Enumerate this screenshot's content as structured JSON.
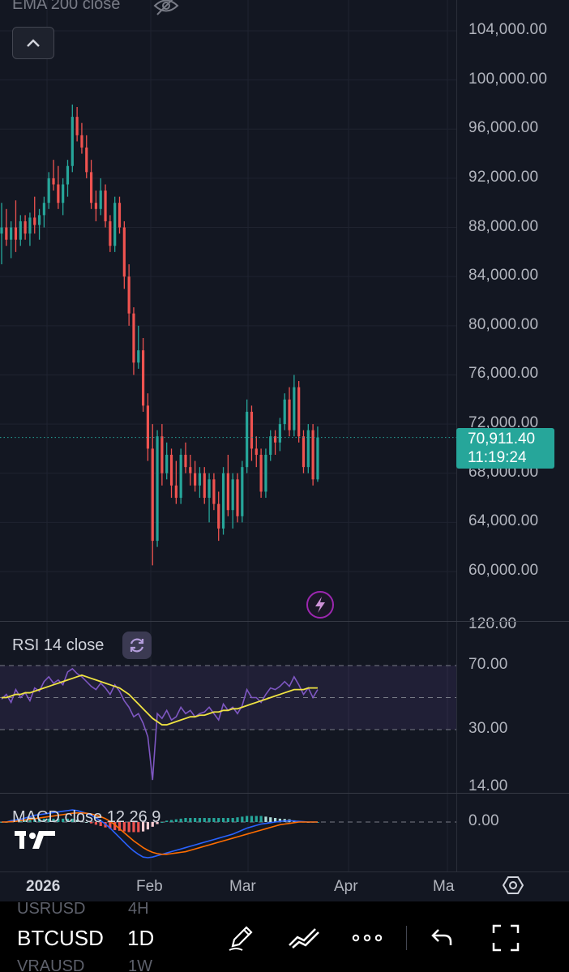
{
  "legend": {
    "ema": "EMA 200 close",
    "rsi": "RSI 14 close",
    "macd": "MACD close 12 26 9"
  },
  "price_axis": [
    "104,000.00",
    "100,000.00",
    "96,000.00",
    "92,000.00",
    "88,000.00",
    "84,000.00",
    "80,000.00",
    "76,000.00",
    "72,000.00",
    "68,000.00",
    "64,000.00",
    "60,000.00"
  ],
  "rsi_axis": [
    "120.00",
    "70.00",
    "30.00",
    "14.00"
  ],
  "macd_axis": [
    "0.00"
  ],
  "time_axis": [
    "2026",
    "Feb",
    "Mar",
    "Apr",
    "Ma"
  ],
  "last_price": {
    "value": "70,911.40",
    "countdown": "11:19:24"
  },
  "toolbar": {
    "symbol": "BTCUSD",
    "interval": "1D",
    "ghost_symbols": [
      "USRUSD",
      "VRAUSD"
    ],
    "ghost_intervals": [
      "4H",
      "1W"
    ]
  },
  "icons": {
    "eye": "eye-off-icon",
    "collapse": "chevron-up-icon",
    "bolt": "lightning-icon",
    "reload": "reload-icon",
    "settings": "gear-icon",
    "draw": "pencil-icon",
    "indicators": "indicators-icon",
    "more": "more-dots-icon",
    "undo": "undo-icon",
    "fullscreen": "fullscreen-icon"
  },
  "colors": {
    "up": "#26a69a",
    "down": "#ef5350",
    "rsi": "#7e57c2",
    "rsi_ma": "#f0e442",
    "macd": "#2962ff",
    "signal": "#ff6d00",
    "badge": "#26a69a"
  },
  "chart_data": {
    "type": "candlestick",
    "price_range": [
      58000,
      106000
    ],
    "candles": [
      [
        87500,
        90000,
        85000,
        88000
      ],
      [
        88000,
        89500,
        86500,
        87000
      ],
      [
        87000,
        88500,
        85500,
        88000
      ],
      [
        88000,
        90200,
        86000,
        87000
      ],
      [
        87000,
        89000,
        86500,
        88500
      ],
      [
        88500,
        89000,
        87000,
        87500
      ],
      [
        87500,
        89200,
        86500,
        88800
      ],
      [
        88800,
        90500,
        87500,
        88200
      ],
      [
        88200,
        89500,
        87000,
        89000
      ],
      [
        89000,
        90500,
        88000,
        90000
      ],
      [
        90000,
        92500,
        89500,
        92000
      ],
      [
        92000,
        93500,
        91000,
        91500
      ],
      [
        91500,
        93000,
        89500,
        90000
      ],
      [
        90000,
        92000,
        89000,
        91500
      ],
      [
        91500,
        93500,
        90500,
        93000
      ],
      [
        93000,
        98000,
        92500,
        97000
      ],
      [
        97000,
        97800,
        95000,
        95500
      ],
      [
        95500,
        96500,
        94000,
        94500
      ],
      [
        94500,
        95500,
        92000,
        92500
      ],
      [
        92500,
        93500,
        89500,
        90000
      ],
      [
        90000,
        91000,
        88500,
        89500
      ],
      [
        89500,
        92000,
        89000,
        91000
      ],
      [
        91000,
        91500,
        88000,
        88500
      ],
      [
        88500,
        89000,
        86000,
        86500
      ],
      [
        86500,
        90500,
        86000,
        90000
      ],
      [
        90000,
        90500,
        87500,
        88000
      ],
      [
        88000,
        88500,
        83000,
        84000
      ],
      [
        84000,
        85000,
        80000,
        81000
      ],
      [
        81000,
        81500,
        76000,
        77000
      ],
      [
        77000,
        80000,
        76500,
        78000
      ],
      [
        78000,
        79000,
        73000,
        73500
      ],
      [
        73500,
        74500,
        69000,
        70000
      ],
      [
        70000,
        72000,
        60500,
        62500
      ],
      [
        62500,
        71500,
        62000,
        71000
      ],
      [
        71000,
        72000,
        67000,
        68000
      ],
      [
        68000,
        70500,
        67500,
        69500
      ],
      [
        69500,
        70000,
        66000,
        67000
      ],
      [
        67000,
        69000,
        65500,
        66000
      ],
      [
        66000,
        70000,
        65500,
        69500
      ],
      [
        69500,
        70500,
        68000,
        68500
      ],
      [
        68500,
        69500,
        67000,
        68000
      ],
      [
        68000,
        69000,
        66500,
        67000
      ],
      [
        67000,
        68500,
        66000,
        68000
      ],
      [
        68000,
        68500,
        65500,
        66000
      ],
      [
        66000,
        68000,
        64000,
        67500
      ],
      [
        67500,
        68000,
        65000,
        65500
      ],
      [
        65500,
        66500,
        62500,
        63500
      ],
      [
        63500,
        68500,
        63000,
        68000
      ],
      [
        68000,
        69500,
        64500,
        65000
      ],
      [
        65000,
        68000,
        63500,
        67500
      ],
      [
        67500,
        68000,
        64000,
        64500
      ],
      [
        64500,
        69000,
        64000,
        68500
      ],
      [
        68500,
        74000,
        68000,
        73000
      ],
      [
        73000,
        73500,
        69000,
        70000
      ],
      [
        70000,
        71000,
        68500,
        69500
      ],
      [
        69500,
        70000,
        66000,
        66500
      ],
      [
        66500,
        70000,
        66000,
        69500
      ],
      [
        69500,
        71500,
        69000,
        71000
      ],
      [
        71000,
        71500,
        69500,
        70500
      ],
      [
        70500,
        72500,
        69800,
        72000
      ],
      [
        72000,
        74500,
        71500,
        74000
      ],
      [
        74000,
        75000,
        71000,
        71500
      ],
      [
        71500,
        76000,
        71000,
        75000
      ],
      [
        75000,
        75500,
        70500,
        71000
      ],
      [
        71000,
        71500,
        68000,
        68500
      ],
      [
        68500,
        72000,
        68000,
        71500
      ],
      [
        71500,
        72000,
        67000,
        67500
      ],
      [
        67500,
        71800,
        67300,
        70911
      ]
    ],
    "rsi": {
      "range": [
        14,
        120
      ],
      "bands": [
        70,
        30
      ],
      "values": [
        49,
        52,
        47,
        55,
        50,
        53,
        48,
        56,
        54,
        60,
        63,
        59,
        61,
        58,
        66,
        68,
        65,
        63,
        60,
        57,
        55,
        59,
        56,
        52,
        58,
        54,
        48,
        44,
        38,
        40,
        34,
        28,
        16,
        40,
        37,
        42,
        36,
        38,
        44,
        40,
        42,
        38,
        40,
        41,
        44,
        40,
        36,
        46,
        42,
        44,
        40,
        45,
        55,
        50,
        50,
        47,
        52,
        56,
        55,
        57,
        60,
        57,
        63,
        58,
        52,
        56,
        50,
        55
      ],
      "ma": [
        50,
        50,
        51,
        52,
        52,
        53,
        53,
        54,
        55,
        56,
        57,
        58,
        59,
        60,
        61,
        62,
        63,
        64,
        63,
        62,
        61,
        60,
        59,
        58,
        57,
        56,
        54,
        52,
        49,
        46,
        43,
        40,
        37,
        35,
        33,
        33,
        34,
        35,
        36,
        37,
        38,
        38,
        39,
        39,
        40,
        41,
        41,
        42,
        42,
        43,
        43,
        44,
        45,
        46,
        47,
        48,
        49,
        50,
        51,
        52,
        53,
        54,
        55,
        55,
        55,
        56,
        56,
        56
      ]
    },
    "macd": {
      "macd": [
        0,
        0,
        200,
        300,
        400,
        600,
        800,
        1000,
        1100,
        1200,
        1300,
        1400,
        1500,
        1600,
        1700,
        1800,
        1700,
        1500,
        1300,
        1000,
        600,
        200,
        -300,
        -900,
        -1600,
        -2300,
        -3000,
        -3700,
        -4300,
        -4800,
        -5200,
        -5300,
        -5200,
        -5000,
        -4800,
        -4600,
        -4400,
        -4200,
        -4000,
        -3800,
        -3600,
        -3400,
        -3200,
        -3000,
        -2800,
        -2600,
        -2400,
        -2200,
        -2000,
        -1800,
        -1500,
        -1200,
        -900,
        -700,
        -500,
        -300,
        -200,
        -100,
        0,
        100,
        150,
        200,
        150,
        100,
        50,
        0,
        0,
        0
      ],
      "signal": [
        0,
        0,
        50,
        100,
        200,
        300,
        400,
        500,
        600,
        700,
        800,
        900,
        1000,
        1100,
        1200,
        1300,
        1350,
        1350,
        1300,
        1200,
        1000,
        800,
        500,
        100,
        -400,
        -1000,
        -1600,
        -2200,
        -2800,
        -3300,
        -3800,
        -4200,
        -4500,
        -4700,
        -4800,
        -4800,
        -4700,
        -4600,
        -4500,
        -4400,
        -4200,
        -4000,
        -3800,
        -3600,
        -3400,
        -3200,
        -3000,
        -2800,
        -2600,
        -2400,
        -2200,
        -2000,
        -1800,
        -1600,
        -1400,
        -1200,
        -1000,
        -800,
        -600,
        -400,
        -300,
        -200,
        -100,
        0,
        0,
        0,
        0,
        0
      ]
    }
  }
}
